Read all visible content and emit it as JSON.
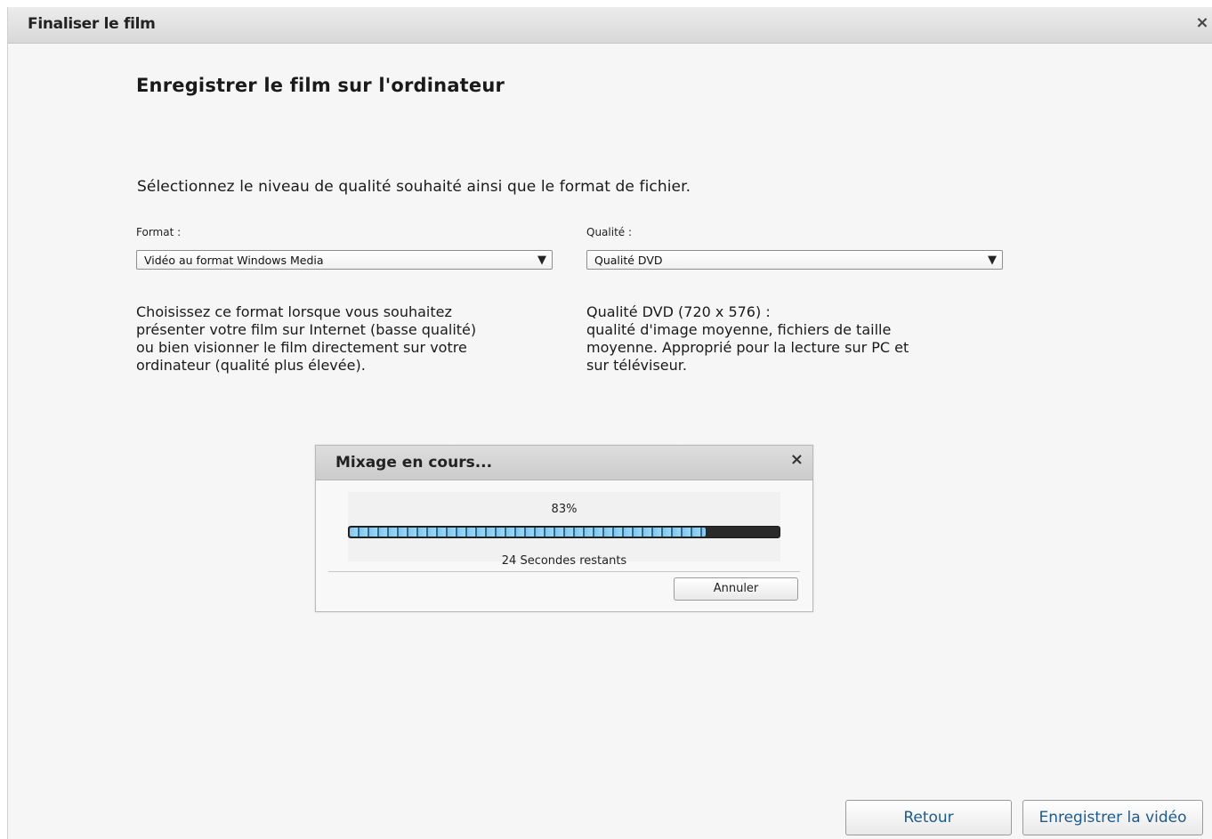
{
  "window": {
    "title": "Finaliser le film",
    "close_glyph": "×"
  },
  "page": {
    "heading": "Enregistrer le film sur l'ordinateur",
    "instruction": "Sélectionnez le niveau de qualité souhaité ainsi que le format de fichier."
  },
  "format": {
    "label": "Format :",
    "selected": "Vidéo au format Windows Media",
    "arrow_icon": "▼",
    "description_lines": [
      "Choisissez ce format lorsque vous souhaitez",
      "présenter votre film sur Internet (basse qualité)",
      "ou bien visionner le film directement sur votre",
      "ordinateur (qualité plus élevée)."
    ]
  },
  "quality": {
    "label": "Qualité :",
    "selected": "Qualité DVD",
    "arrow_icon": "▼",
    "description_lines": [
      "Qualité DVD (720 x 576) :",
      "qualité d'image moyenne, fichiers de taille",
      "moyenne. Approprié pour la lecture sur PC et",
      "sur téléviseur."
    ]
  },
  "progress_dialog": {
    "title": "Mixage en cours...",
    "close_glyph": "×",
    "percent_label": "83%",
    "progress_fraction": 0.83,
    "remaining_label": "24 Secondes restants",
    "cancel_label": "Annuler"
  },
  "footer": {
    "back_label": "Retour",
    "save_label": "Enregistrer la vidéo"
  },
  "colors": {
    "progress_fill": "#7cc7ef",
    "footer_button_text": "#1d5b8f"
  }
}
